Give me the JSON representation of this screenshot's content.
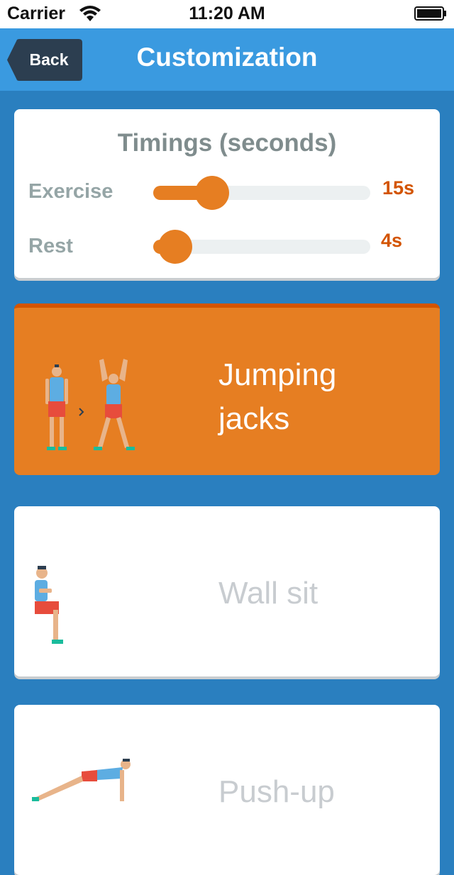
{
  "status_bar": {
    "carrier": "Carrier",
    "time": "11:20 AM"
  },
  "nav": {
    "back_label": "Back",
    "title": "Customization"
  },
  "timings": {
    "title": "Timings (seconds)",
    "rows": [
      {
        "label": "Exercise",
        "value": "15s",
        "level": 0.27
      },
      {
        "label": "Rest",
        "value": "4s",
        "level": 0.1
      }
    ]
  },
  "exercises": [
    {
      "name": "Jumping jacks",
      "line1": "Jumping",
      "line2": "jacks",
      "selected": true,
      "icon": "jumping-jacks-illustration"
    },
    {
      "name": "Wall sit",
      "line1": "Wall sit",
      "selected": false,
      "icon": "wall-sit-illustration"
    },
    {
      "name": "Push-up",
      "line1": "Push-up",
      "selected": false,
      "icon": "push-up-illustration"
    }
  ],
  "colors": {
    "primary": "#3a9ae0",
    "background": "#2a7fbf",
    "accent": "#e67e22",
    "accent_dark": "#d35400"
  }
}
